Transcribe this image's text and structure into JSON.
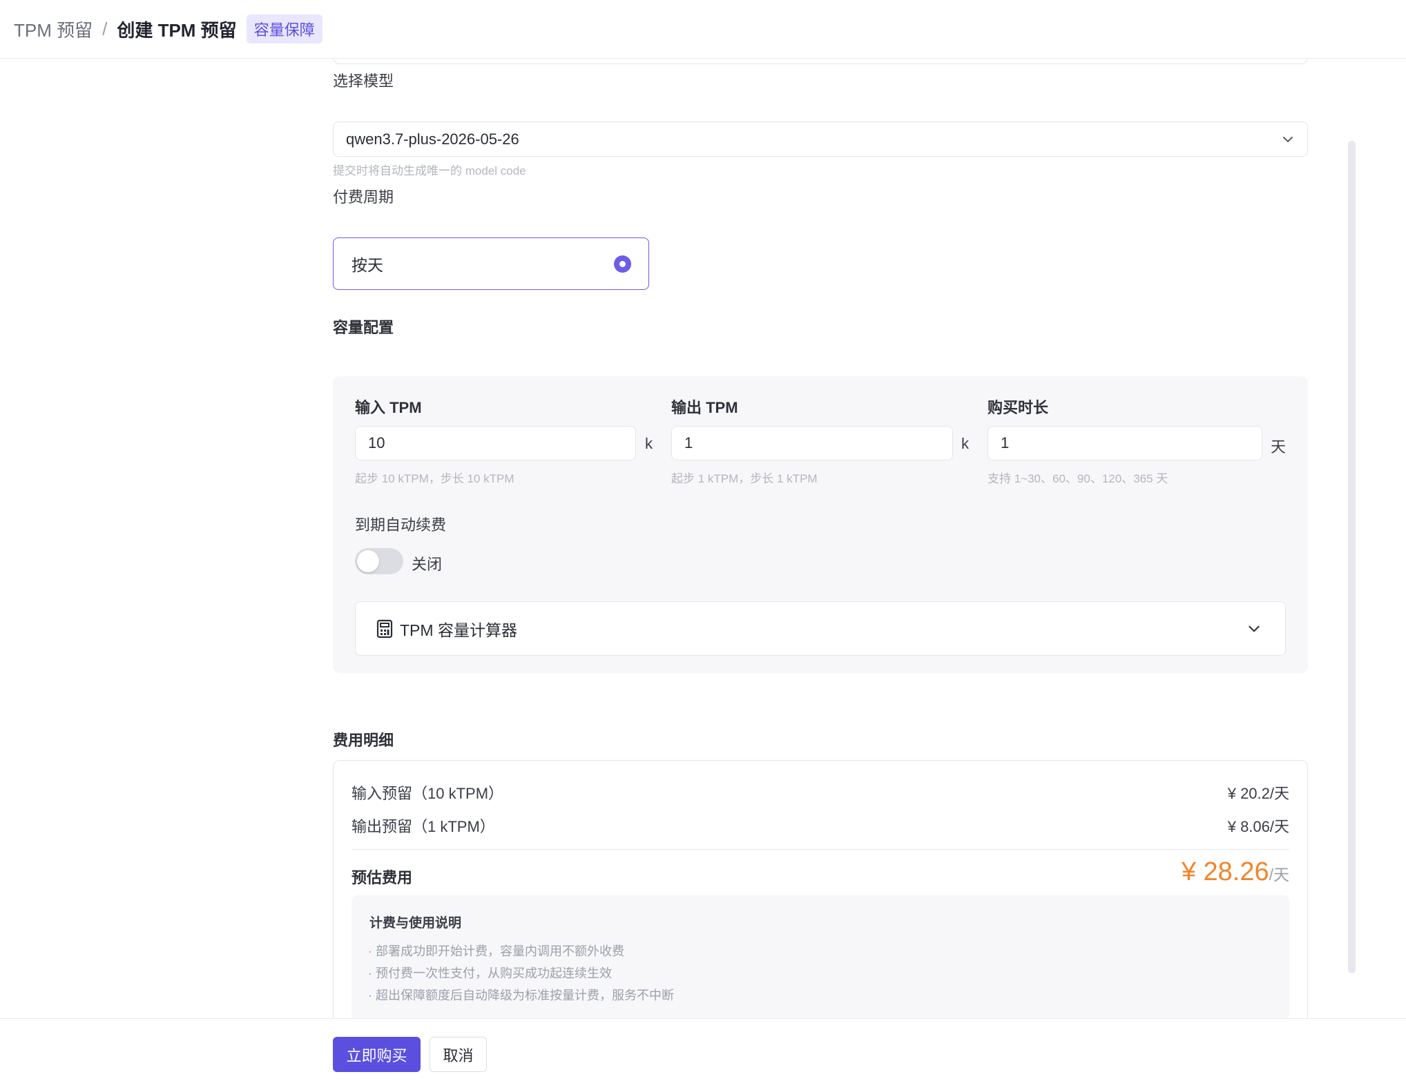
{
  "breadcrumb": {
    "parent": "TPM 预留",
    "separator": "/",
    "current": "创建 TPM 预留",
    "badge": "容量保障"
  },
  "model": {
    "label": "选择模型",
    "value": "qwen3.7-plus-2026-05-26",
    "hint": "提交时将自动生成唯一的 model code"
  },
  "billing_period": {
    "label": "付费周期",
    "option": "按天",
    "selected": true
  },
  "capacity": {
    "title": "容量配置",
    "input_tpm": {
      "label": "输入 TPM",
      "value": "10",
      "unit": "k",
      "hint": "起步 10 kTPM，步长 10 kTPM"
    },
    "output_tpm": {
      "label": "输出 TPM",
      "value": "1",
      "unit": "k",
      "hint": "起步 1 kTPM，步长 1 kTPM"
    },
    "duration": {
      "label": "购买时长",
      "value": "1",
      "unit": "天",
      "hint": "支持 1~30、60、90、120、365 天"
    },
    "auto_renew": {
      "label": "到期自动续费",
      "state": "关闭",
      "enabled": false
    },
    "calculator": {
      "label": "TPM 容量计算器"
    }
  },
  "fees": {
    "title": "费用明细",
    "rows": [
      {
        "label": "输入预留（10 kTPM）",
        "amount": "¥ 20.2/天"
      },
      {
        "label": "输出预留（1 kTPM）",
        "amount": "¥ 8.06/天"
      }
    ],
    "total_label": "预估费用",
    "total_amount": "¥ 28.26",
    "total_unit": "/天",
    "notes_title": "计费与使用说明",
    "notes": [
      "· 部署成功即开始计费，容量内调用不额外收费",
      "· 预付费一次性支付，从购买成功起连续生效",
      "· 超出保障额度后自动降级为标准按量计费，服务不中断"
    ]
  },
  "actions": {
    "buy": "立即购买",
    "cancel": "取消"
  },
  "colors": {
    "accent": "#5b4fe0",
    "price": "#f2842a",
    "badge_bg": "#e9e6ff"
  }
}
